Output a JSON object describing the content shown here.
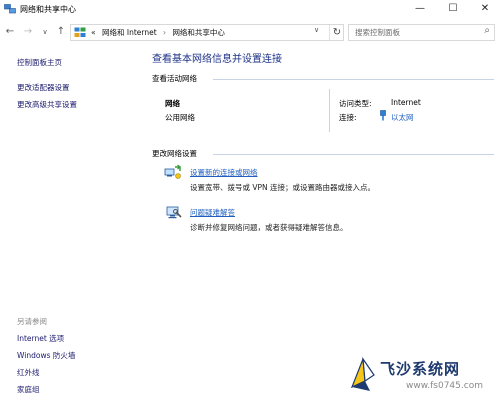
{
  "window": {
    "title": "网络和共享中心",
    "minimize": "—",
    "maximize": "☐",
    "close": "✕"
  },
  "nav": {
    "back": "←",
    "forward": "→",
    "history": "∨",
    "up": "↑",
    "breadcrumbs": [
      "«",
      "网络和 Internet",
      "›",
      "网络和共享中心"
    ],
    "dropdown": "∨",
    "refresh": "↻",
    "search_placeholder": "搜索控制面板",
    "search_icon": "⌕"
  },
  "sidebar": {
    "links": [
      "控制面板主页",
      "更改适配器设置",
      "更改高级共享设置"
    ],
    "see_also_heading": "另请参阅",
    "see_also": [
      "Internet 选项",
      "Windows 防火墙",
      "红外线",
      "家庭组"
    ]
  },
  "main": {
    "title": "查看基本网络信息并设置连接",
    "active_section": "查看活动网络",
    "network": {
      "name": "网络",
      "type": "公用网络",
      "access_label": "访问类型:",
      "access_value": "Internet",
      "connection_label": "连接:",
      "connection_value": "以太网"
    },
    "change_section": "更改网络设置",
    "tasks": [
      {
        "title": "设置新的连接或网络",
        "desc": "设置宽带、拨号或 VPN 连接；或设置路由器或接入点。",
        "icon": "network-setup-icon"
      },
      {
        "title": "问题疑难解答",
        "desc": "诊断并修复网络问题，或者获得疑难解答信息。",
        "icon": "troubleshoot-icon"
      }
    ]
  },
  "watermark": {
    "title": "飞沙系统网",
    "url": "www.fs0745.com"
  },
  "colors": {
    "link": "#1f5fbf",
    "heading": "#1e3287",
    "divider": "#c9d3e6"
  }
}
